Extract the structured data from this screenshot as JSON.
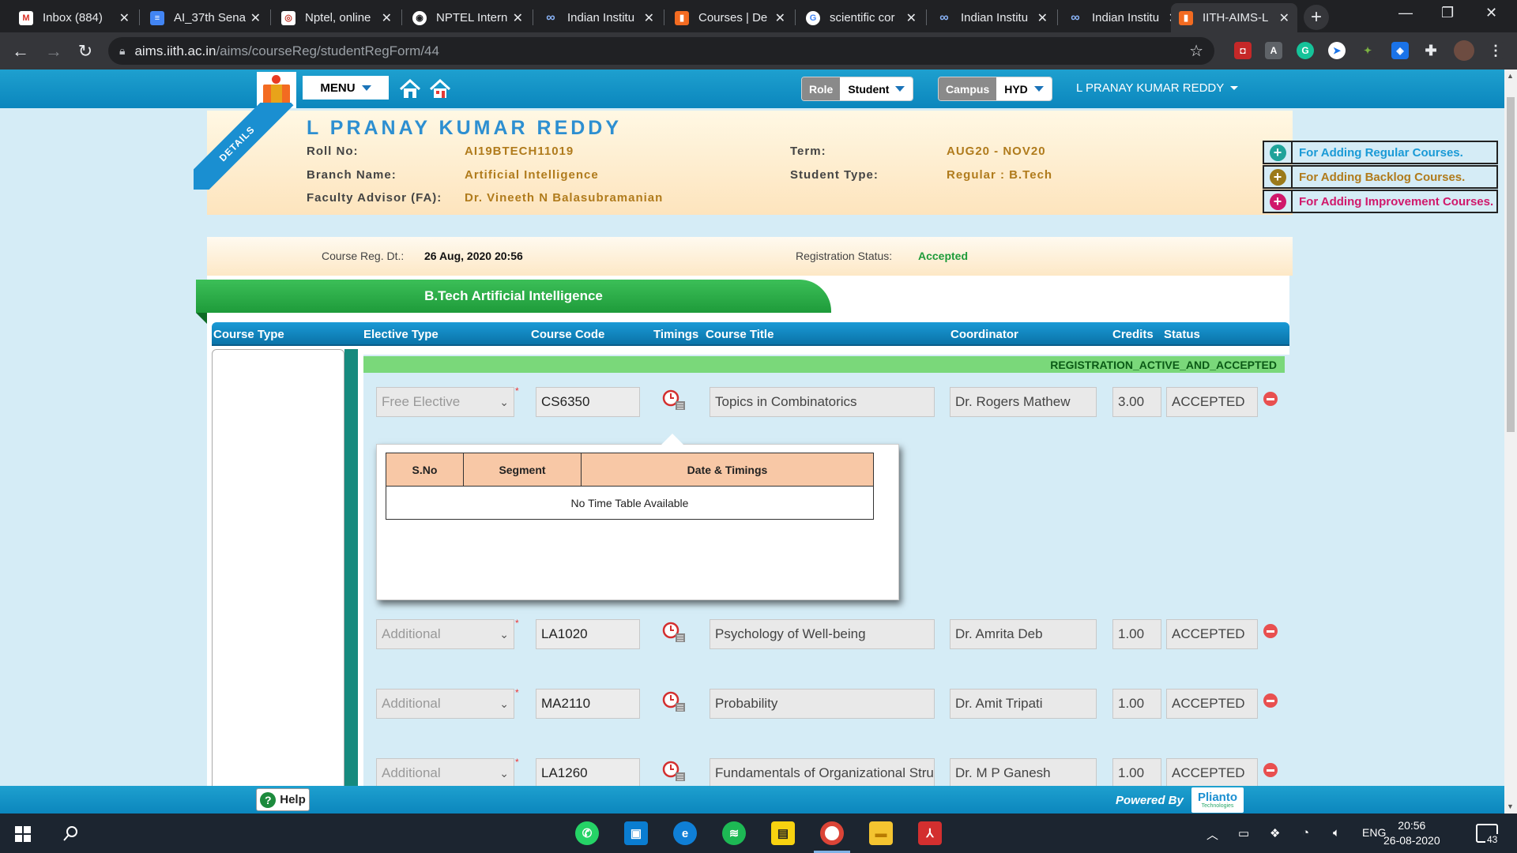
{
  "browser": {
    "tabs": [
      {
        "title": "Inbox (884)"
      },
      {
        "title": "AI_37th Sena"
      },
      {
        "title": "Nptel, online"
      },
      {
        "title": "NPTEL Intern"
      },
      {
        "title": "Indian Institu"
      },
      {
        "title": "Courses | De"
      },
      {
        "title": "scientific cor"
      },
      {
        "title": "Indian Institu"
      },
      {
        "title": "Indian Institu"
      },
      {
        "title": "IITH-AIMS-L"
      }
    ],
    "url_host": "aims.iith.ac.in",
    "url_path": "/aims/courseReg/studentRegForm/44"
  },
  "header": {
    "menu_label": "MENU",
    "role_label": "Role",
    "role_value": "Student",
    "campus_label": "Campus",
    "campus_value": "HYD",
    "user_name": "L PRANAY KUMAR REDDY"
  },
  "details": {
    "ribbon": "DETAILS",
    "name": "L PRANAY KUMAR REDDY",
    "roll_label": "Roll No:",
    "roll_value": "AI19BTECH11019",
    "branch_label": "Branch Name:",
    "branch_value": "Artificial Intelligence",
    "fa_label": "Faculty Advisor (FA):",
    "fa_value": "Dr. Vineeth N Balasubramanian",
    "term_label": "Term:",
    "term_value": "AUG20 - NOV20",
    "type_label": "Student Type:",
    "type_value": "Regular : B.Tech",
    "reg_date_label": "Course Reg. Dt.:",
    "reg_date_value": "26 Aug, 2020 20:56",
    "reg_status_label": "Registration Status:",
    "reg_status_value": "Accepted"
  },
  "add_links": [
    {
      "label": "For Adding Regular Courses.",
      "color": "#1a9ad6"
    },
    {
      "label": "For Adding Backlog Courses.",
      "color": "#b07b1c"
    },
    {
      "label": "For Adding Improvement Courses.",
      "color": "#d0186b"
    }
  ],
  "program_title": "B.Tech Artificial Intelligence",
  "table": {
    "headers": [
      "Course Type",
      "Elective Type",
      "Course Code",
      "Timings",
      "Course Title",
      "Coordinator",
      "Credits",
      "Status"
    ],
    "status_strip": "REGISTRATION_ACTIVE_AND_ACCEPTED",
    "rows": [
      {
        "elective": "Free Elective",
        "code": "CS6350",
        "title": "Topics in Combinatorics",
        "coordinator": "Dr. Rogers Mathew",
        "credits": "3.00",
        "status": "ACCEPTED"
      },
      {
        "elective": "Additional",
        "code": "LA1020",
        "title": "Psychology of Well-being",
        "coordinator": "Dr. Amrita Deb",
        "credits": "1.00",
        "status": "ACCEPTED"
      },
      {
        "elective": "Additional",
        "code": "MA2110",
        "title": "Probability",
        "coordinator": "Dr. Amit Tripati",
        "credits": "1.00",
        "status": "ACCEPTED"
      },
      {
        "elective": "Additional",
        "code": "LA1260",
        "title": "Fundamentals of Organizational Stru",
        "coordinator": "Dr. M P Ganesh",
        "credits": "1.00",
        "status": "ACCEPTED"
      }
    ]
  },
  "timetable_popup": {
    "headers": [
      "S.No",
      "Segment",
      "Date & Timings"
    ],
    "empty_message": "No Time Table Available"
  },
  "footer": {
    "help_label": "Help",
    "powered_by": "Powered By",
    "brand": "Plianto",
    "brand_sub": "Technologies"
  },
  "taskbar": {
    "language": "ENG",
    "time": "20:56",
    "date": "26-08-2020",
    "notifications": "43"
  }
}
